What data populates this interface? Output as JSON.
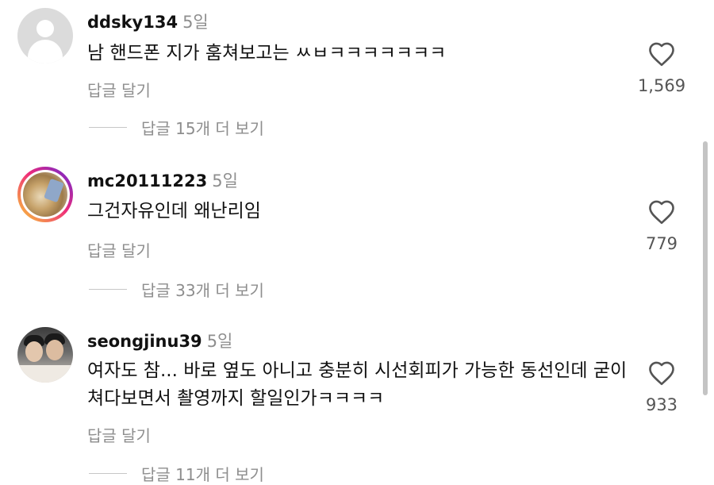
{
  "comments": [
    {
      "username": "ddsky134",
      "time": "5일",
      "text": "남 핸드폰 지가 훔쳐보고는 ㅆㅂㅋㅋㅋㅋㅋㅋㅋ",
      "reply_label": "답글 달기",
      "likes": "1,569",
      "view_replies": "답글 15개 더 보기",
      "avatar": "default-avatar"
    },
    {
      "username": "mc20111223",
      "time": "5일",
      "text": "그건자유인데 왜난리임",
      "reply_label": "답글 달기",
      "likes": "779",
      "view_replies": "답글 33개 더 보기",
      "avatar": "story-ring-avatar"
    },
    {
      "username": "seongjinu39",
      "time": "5일",
      "text": "여자도 참... 바로 옆도 아니고 충분히 시선회피가 가능한 동선인데 굳이 쳐다보면서 촬영까지 할일인가ㅋㅋㅋㅋ",
      "reply_label": "답글 달기",
      "likes": "933",
      "view_replies": "답글 11개 더 보기",
      "avatar": "photo-avatar"
    }
  ],
  "icons": {
    "like": "heart-outline-icon"
  },
  "colors": {
    "secondary_text": "#8e8e8e",
    "primary_text": "#111111"
  }
}
